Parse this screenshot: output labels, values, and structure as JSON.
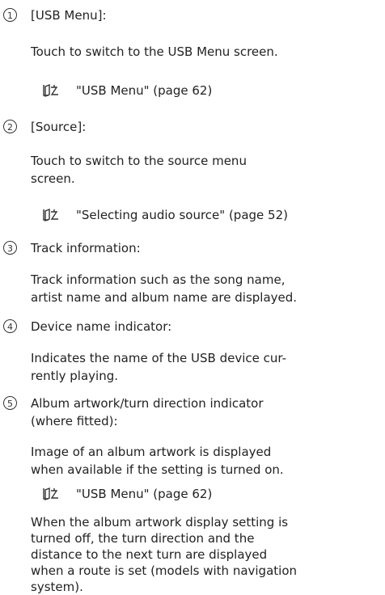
{
  "items": [
    {
      "marker": "1",
      "label": "[USB Menu]:",
      "text": "Touch to switch to the USB Menu screen.",
      "ref": "\"USB Menu\" (page 62)"
    },
    {
      "marker": "2",
      "label": "[Source]:",
      "text_line1": "Touch to switch to the source menu",
      "text_line2": "screen.",
      "ref": "\"Selecting audio source\" (page 52)"
    },
    {
      "marker": "3",
      "label": "Track information:",
      "text_line1": "Track information such as the song name,",
      "text_line2": "artist name and album name are displayed."
    },
    {
      "marker": "4",
      "label": "Device name indicator:",
      "text_line1": "Indicates the name of the USB device cur-",
      "text_line2": "rently playing."
    },
    {
      "marker": "5",
      "label_line1": "Album artwork/turn direction indicator",
      "label_line2": "(where fitted):",
      "text_line1": "Image of an album artwork is displayed",
      "text_line2": "when available if the setting is turned on.",
      "ref": "\"USB Menu\" (page 62)",
      "text2_line1": "When the album artwork display setting is",
      "text2_line2": "turned off, the turn direction and the",
      "text2_line3": "distance to the next turn are displayed",
      "text2_line4": "when a route is set (models with navigation",
      "text2_line5": "system)."
    }
  ],
  "ref_icon": "reference-book-icon"
}
